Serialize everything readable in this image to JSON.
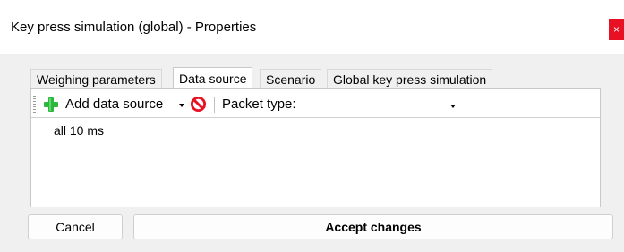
{
  "window": {
    "title": "Key press simulation (global) - Properties",
    "close_glyph": "×",
    "close_color": "#e81123"
  },
  "tabs": [
    {
      "label": "Weighing parameters",
      "active": false
    },
    {
      "label": "Data source",
      "active": true
    },
    {
      "label": "Scenario",
      "active": false
    },
    {
      "label": "Global key press simulation",
      "active": false
    }
  ],
  "toolbar": {
    "add_icon": "plus-icon",
    "add_icon_color": "#2db83d",
    "add_label": "Add data source",
    "remove_icon": "prohibit-icon",
    "remove_icon_color": "#e81123",
    "packet_type_label": "Packet type:",
    "packet_type_value": ""
  },
  "tree": {
    "items": [
      {
        "label": "all 10 ms"
      }
    ]
  },
  "buttons": {
    "cancel_label": "Cancel",
    "accept_label": "Accept changes"
  }
}
